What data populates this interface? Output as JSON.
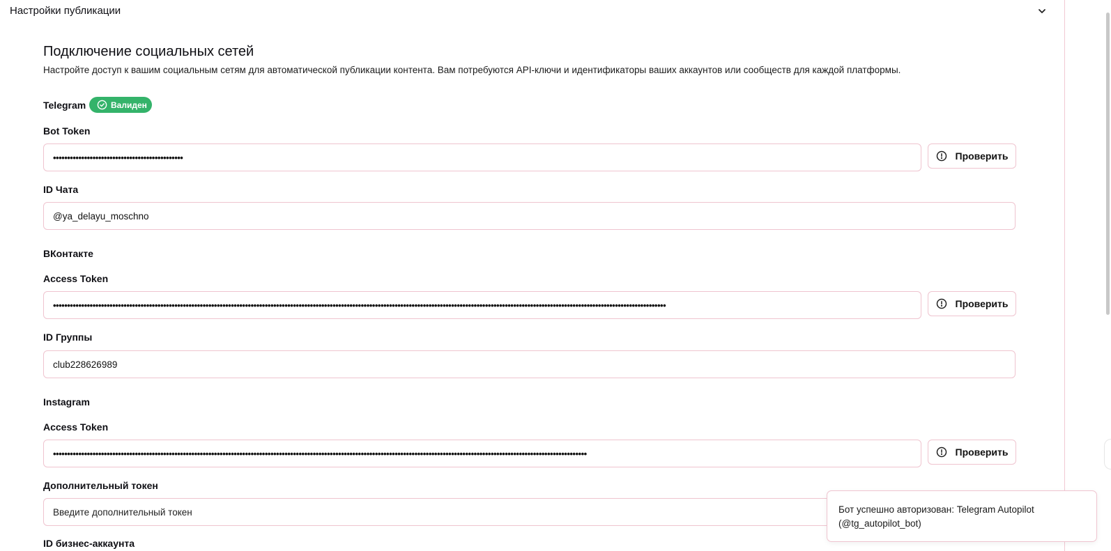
{
  "accordion": {
    "title": "Настройки публикации",
    "chevron_icon": "chevron-down-icon"
  },
  "section": {
    "title": "Подключение социальных сетей",
    "description": "Настройте доступ к вашим социальным сетям для автоматической публикации контента. Вам потребуются API-ключи и идентификаторы ваших аккаунтов или сообществ для каждой платформы."
  },
  "telegram": {
    "name": "Telegram",
    "badge": "Валиден",
    "badge_color": "#34b36a",
    "token_label": "Bot Token",
    "token_value": "••••••••••••••••••••••••••••••••••••••••••••••",
    "check_label": "Проверить",
    "chat_label": "ID Чата",
    "chat_value": "@ya_delayu_moschno"
  },
  "vk": {
    "name": "ВКонтакте",
    "token_label": "Access Token",
    "token_value": "•••••••••••••••••••••••••••••••••••••••••••••••••••••••••••••••••••••••••••••••••••••••••••••••••••••••••••••••••••••••••••••••••••••••••••••••••••••••••••••••••••••••••••••••••••••••••••••••••••••••••••••••••••••••••",
    "check_label": "Проверить",
    "group_label": "ID Группы",
    "group_value": "club228626989"
  },
  "instagram": {
    "name": "Instagram",
    "token_label": "Access Token",
    "token_value": "•••••••••••••••••••••••••••••••••••••••••••••••••••••••••••••••••••••••••••••••••••••••••••••••••••••••••••••••••••••••••••••••••••••••••••••••••••••••••••••••••••••••••••••••••••••••••••••",
    "check_label": "Проверить",
    "extra_label": "Дополнительный токен",
    "extra_placeholder": "Введите дополнительный токен",
    "business_label": "ID бизнес-аккаунта"
  },
  "toast": {
    "message": "Бот успешно авторизован: Telegram Autopilot (@tg_autopilot_bot)"
  },
  "colors": {
    "accent_border": "#efc4cf",
    "success": "#34b36a"
  }
}
